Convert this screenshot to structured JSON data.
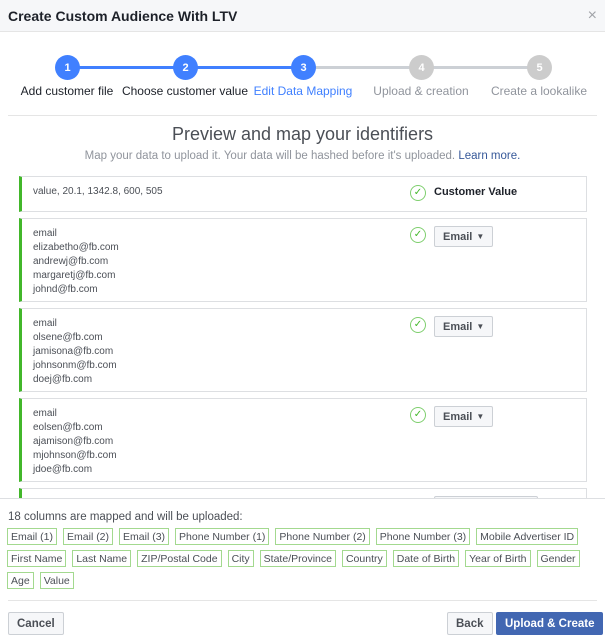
{
  "dialog": {
    "title": "Create Custom Audience With LTV",
    "close_icon": "×"
  },
  "steps": [
    {
      "num": "1",
      "label": "Add customer file",
      "state": "done"
    },
    {
      "num": "2",
      "label": "Choose customer value",
      "state": "done"
    },
    {
      "num": "3",
      "label": "Edit Data Mapping",
      "state": "active"
    },
    {
      "num": "4",
      "label": "Upload & creation",
      "state": "pending"
    },
    {
      "num": "5",
      "label": "Create a lookalike",
      "state": "pending"
    }
  ],
  "colors": {
    "accent": "#4080ff",
    "pending": "#cccccc",
    "mapped": "#42b72a",
    "primary": "#4267b2"
  },
  "main": {
    "title": "Preview and map your identifiers",
    "subtitle": "Map your data to upload it. Your data will be hashed before it's uploaded.",
    "learn_more": "Learn more."
  },
  "rows": [
    {
      "lines": [
        "value, 20.1, 1342.8, 600, 505"
      ],
      "mapping": "Customer Value"
    },
    {
      "lines": [
        "email",
        "elizabetho@fb.com",
        "andrewj@fb.com",
        "margaretj@fb.com",
        "johnd@fb.com"
      ],
      "mapping": "Email"
    },
    {
      "lines": [
        "email",
        "olsene@fb.com",
        "jamisona@fb.com",
        "johnsonm@fb.com",
        "doej@fb.com"
      ],
      "mapping": "Email"
    },
    {
      "lines": [
        "email",
        "eolsen@fb.com",
        "ajamison@fb.com",
        "mjohnson@fb.com",
        "jdoe@fb.com"
      ],
      "mapping": "Email"
    }
  ],
  "summary": {
    "text": "18 columns are mapped and will be uploaded:",
    "chips": [
      "Email (1)",
      "Email (2)",
      "Email (3)",
      "Phone Number (1)",
      "Phone Number (2)",
      "Phone Number (3)",
      "Mobile Advertiser ID",
      "First Name",
      "Last Name",
      "ZIP/Postal Code",
      "City",
      "State/Province",
      "Country",
      "Date of Birth",
      "Year of Birth",
      "Gender",
      "Age",
      "Value"
    ]
  },
  "footer": {
    "cancel": "Cancel",
    "back": "Back",
    "upload": "Upload & Create"
  }
}
